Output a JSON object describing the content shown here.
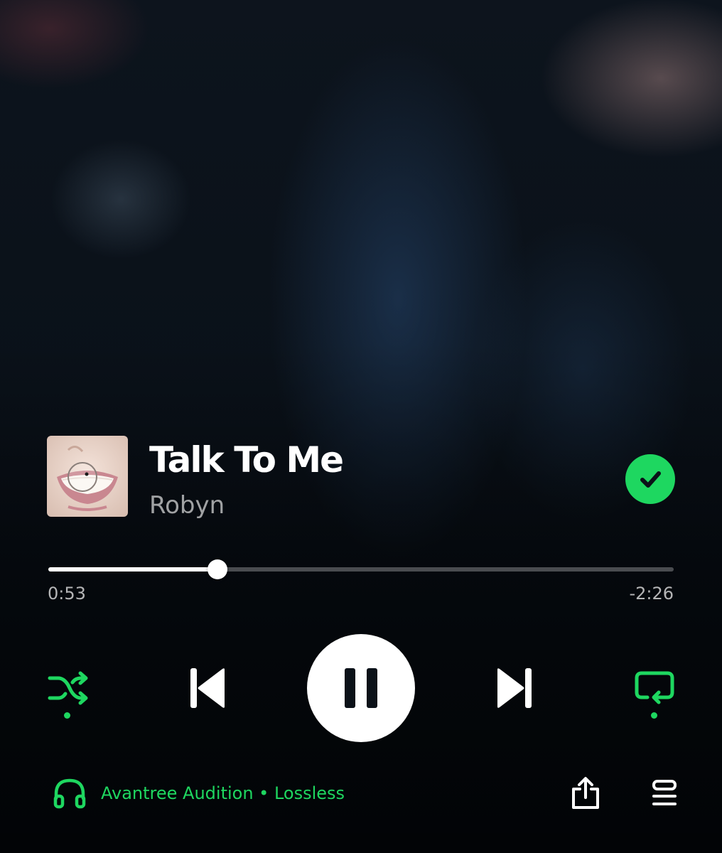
{
  "player": {
    "track_title": "Talk To Me",
    "artist": "Robyn",
    "saved": true,
    "progress_fraction": 0.27,
    "elapsed": "0:53",
    "remaining": "-2:26",
    "shuffle_enabled": true,
    "repeat_enabled": true,
    "is_playing": true
  },
  "footer": {
    "device_label": "Avantree Audition • Lossless"
  },
  "icons": {
    "saved": "check-circle-icon",
    "shuffle": "shuffle-icon",
    "previous": "skip-previous-icon",
    "pause": "pause-icon",
    "next": "skip-next-icon",
    "repeat": "repeat-icon",
    "device": "headphones-icon",
    "share": "share-icon",
    "queue": "queue-icon"
  },
  "colors": {
    "accent": "#1ed760",
    "background": "#0b1118",
    "text_primary": "#ffffff",
    "text_secondary": "#a6aab0"
  }
}
